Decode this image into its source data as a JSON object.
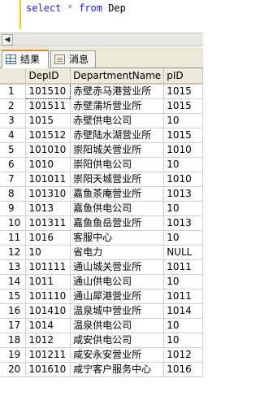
{
  "editor": {
    "keyword_select": "select",
    "star": "*",
    "keyword_from": "from",
    "table_name": "Dep"
  },
  "tabs": [
    {
      "label": "结果",
      "icon": "results-grid-icon",
      "active": true
    },
    {
      "label": "消息",
      "icon": "messages-icon",
      "active": false
    }
  ],
  "grid": {
    "columns": [
      "",
      "DepID",
      "DepartmentName",
      "pID"
    ],
    "rows": [
      [
        "1",
        "101510",
        "赤壁赤马港营业所",
        "1015"
      ],
      [
        "2",
        "101511",
        "赤壁蒲圻营业所",
        "1015"
      ],
      [
        "3",
        "1015",
        "赤壁供电公司",
        "10"
      ],
      [
        "4",
        "101512",
        "赤壁陆水湖营业所",
        "1015"
      ],
      [
        "5",
        "101010",
        "崇阳城关营业所",
        "1010"
      ],
      [
        "6",
        "1010",
        "崇阳供电公司",
        "10"
      ],
      [
        "7",
        "101011",
        "崇阳天城营业所",
        "1010"
      ],
      [
        "8",
        "101310",
        "嘉鱼茶庵营业所",
        "1013"
      ],
      [
        "9",
        "1013",
        "嘉鱼供电公司",
        "10"
      ],
      [
        "10",
        "101311",
        "嘉鱼鱼岳营业所",
        "1013"
      ],
      [
        "11",
        "1016",
        "客服中心",
        "10"
      ],
      [
        "12",
        "10",
        "省电力",
        "NULL"
      ],
      [
        "13",
        "101111",
        "通山城关营业所",
        "1011"
      ],
      [
        "14",
        "1011",
        "通山供电公司",
        "10"
      ],
      [
        "15",
        "101110",
        "通山犀港营业所",
        "1011"
      ],
      [
        "16",
        "101410",
        "温泉城中营业所",
        "1014"
      ],
      [
        "17",
        "1014",
        "温泉供电公司",
        "10"
      ],
      [
        "18",
        "1012",
        "咸安供电公司",
        "10"
      ],
      [
        "19",
        "101211",
        "咸安永安营业所",
        "1012"
      ],
      [
        "20",
        "101610",
        "咸宁客户服务中心",
        "1016"
      ]
    ]
  }
}
